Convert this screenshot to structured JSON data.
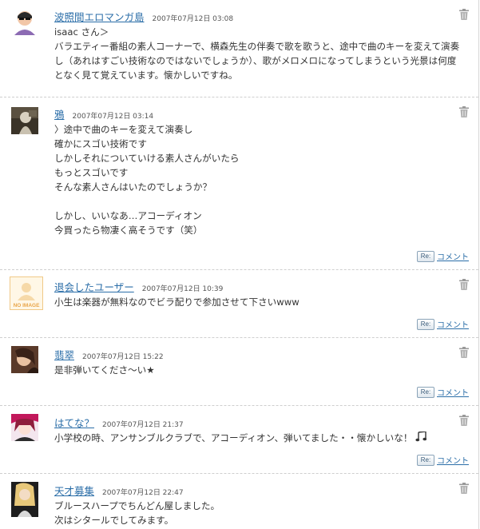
{
  "reply_badge": "Re:",
  "reply_label": "コメント",
  "comments": [
    {
      "user": "波照間エロマンガ島",
      "date": "2007年07月12日 03:08",
      "lines": [
        "isaac さん＞",
        "バラエティー番組の素人コーナーで、横森先生の伴奏で歌を歌うと、途中で曲のキーを変えて演奏し（あれはすごい技術なのではないでしょうか）、歌がメロメロになってしまうという光景は何度となく見て覚えています。懐かしいですね。"
      ]
    },
    {
      "user": "鴉",
      "date": "2007年07月12日 03:14",
      "lines": [
        "〉途中で曲のキーを変えて演奏し",
        "確かにスゴい技術です",
        "しかしそれについていける素人さんがいたら",
        "もっとスゴいです",
        "そんな素人さんはいたのでしょうか？",
        "",
        "しかし、いいなあ…アコーディオン",
        "今買ったら物凄く高そうです（笑）"
      ]
    },
    {
      "user": "退会したユーザー",
      "date": "2007年07月12日 10:39",
      "avatar_text": "NO IMAGE",
      "lines": [
        "小生は楽器が無料なのでビラ配りで参加させて下さいwww"
      ]
    },
    {
      "user": "翡翠",
      "date": "2007年07月12日 15:22",
      "lines": [
        "是非弾いてくださ〜い★"
      ]
    },
    {
      "user": "はてな？",
      "date": "2007年07月12日 21:37",
      "lines": [
        "小学校の時、アンサンブルクラブで、アコーディオン、弾いてました・・懐かしいな！"
      ]
    },
    {
      "user": "天才募集",
      "date": "2007年07月12日 22:47",
      "lines": [
        "ブルースハープでちんどん屋しました。",
        "次はシタールでしてみます。"
      ]
    }
  ]
}
